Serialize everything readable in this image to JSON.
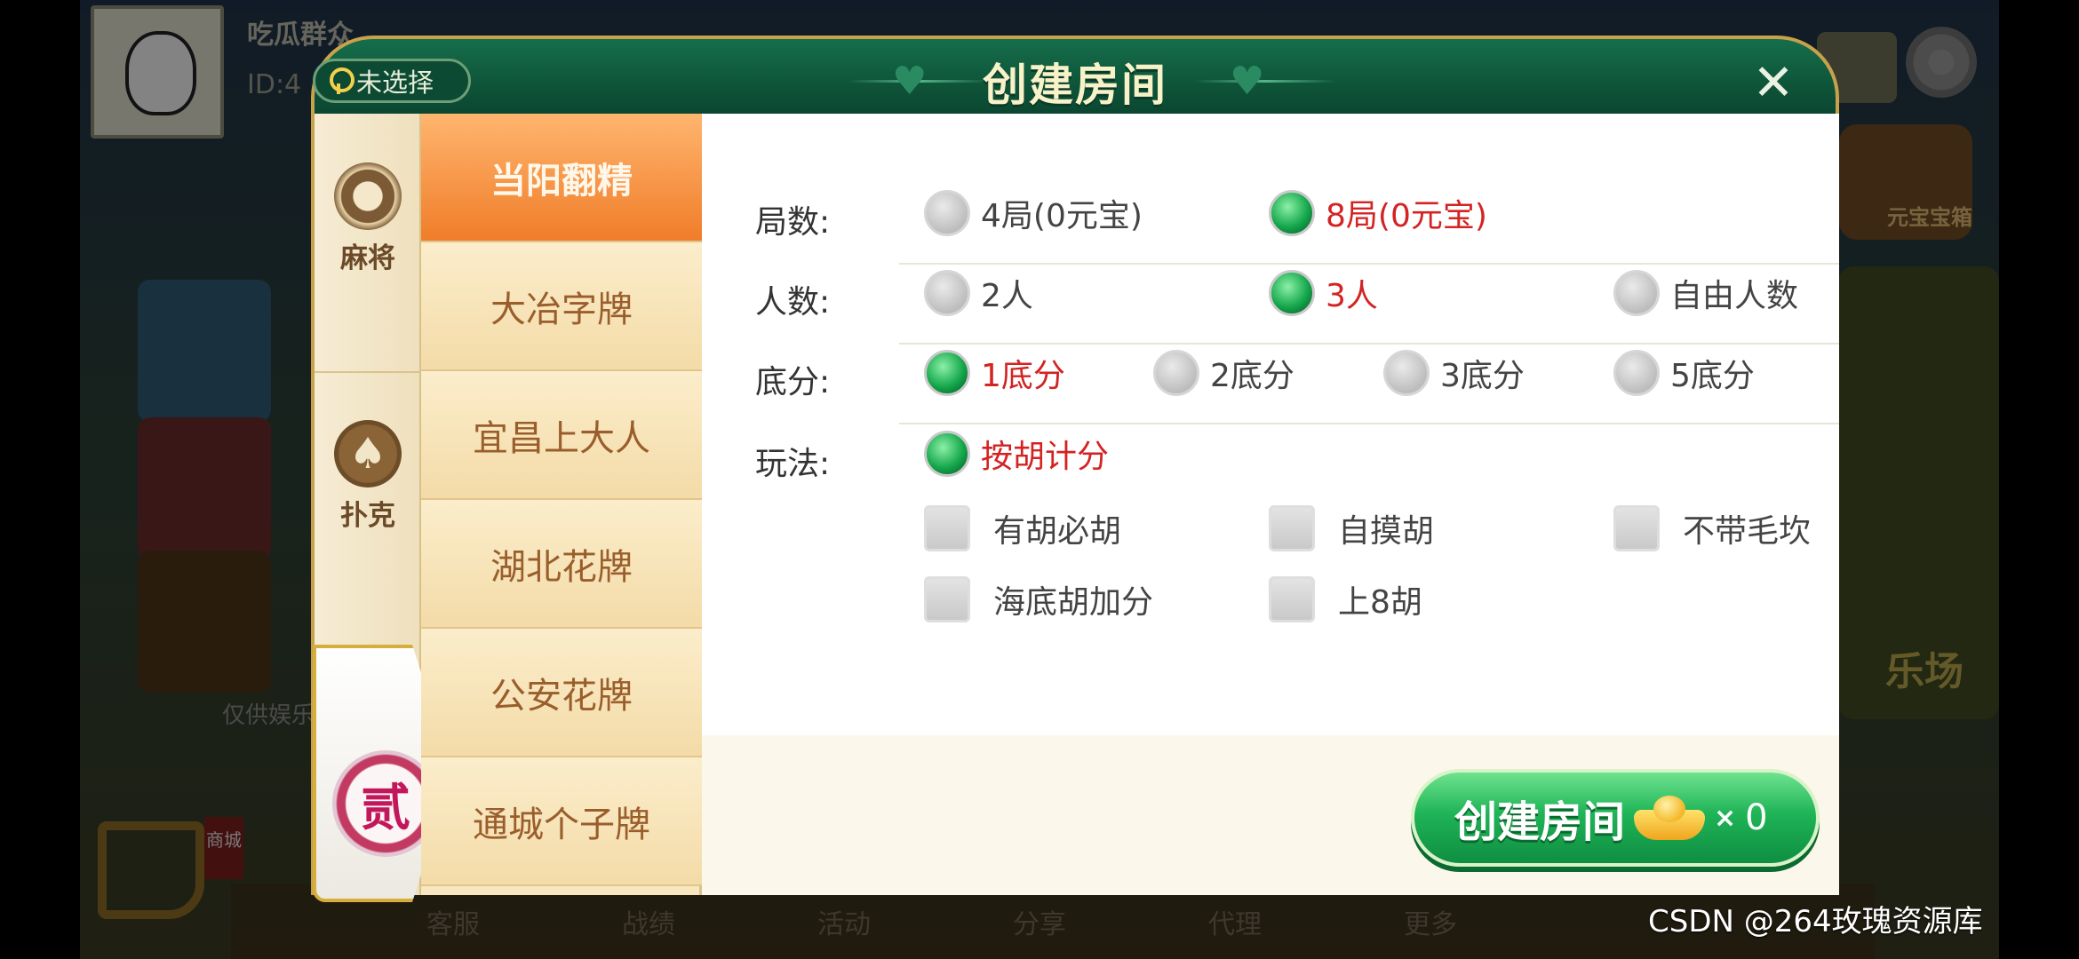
{
  "background": {
    "player_name": "吃瓜群众",
    "player_id": "ID:4",
    "treasure_label": "元宝宝箱",
    "disclaimer": "仅供娱乐",
    "right_card_label": "乐场",
    "cart_label": "商城",
    "bottom_nav": [
      "客服",
      "战绩",
      "活动",
      "分享",
      "代理",
      "更多"
    ]
  },
  "dialog": {
    "title": "创建房间",
    "location_label": "未选择",
    "close_label": "✕"
  },
  "categories": [
    {
      "label": "麻将",
      "icon": "mahjong-icon"
    },
    {
      "label": "扑克",
      "icon": "spade-icon"
    },
    {
      "label": "贰",
      "icon": "er-badge-icon",
      "active": true
    }
  ],
  "games": [
    {
      "label": "当阳翻精",
      "active": true
    },
    {
      "label": "大冶字牌"
    },
    {
      "label": "宜昌上大人"
    },
    {
      "label": "湖北花牌"
    },
    {
      "label": "公安花牌"
    },
    {
      "label": "通城个子牌"
    }
  ],
  "options": {
    "rounds": {
      "label": "局数:",
      "choices": [
        "4局(0元宝)",
        "8局(0元宝)"
      ],
      "selected": "8局(0元宝)"
    },
    "players": {
      "label": "人数:",
      "choices": [
        "2人",
        "3人",
        "自由人数"
      ],
      "selected": "3人"
    },
    "base_score": {
      "label": "底分:",
      "choices": [
        "1底分",
        "2底分",
        "3底分",
        "5底分"
      ],
      "selected": "1底分"
    },
    "play_mode": {
      "label": "玩法:",
      "choices": [
        "按胡计分"
      ],
      "selected": "按胡计分",
      "checkboxes": [
        "有胡必胡",
        "自摸胡",
        "不带毛坎",
        "海底胡加分",
        "上8胡"
      ]
    }
  },
  "create_button": {
    "label": "创建房间",
    "times": "×",
    "cost": "0"
  },
  "watermark": "CSDN @264玫瑰资源库",
  "colors": {
    "header_green": "#0e5338",
    "gold_border": "#c7a24b",
    "selected_red": "#d32323",
    "active_orange": "#f07d2a",
    "button_green": "#1fb457"
  }
}
